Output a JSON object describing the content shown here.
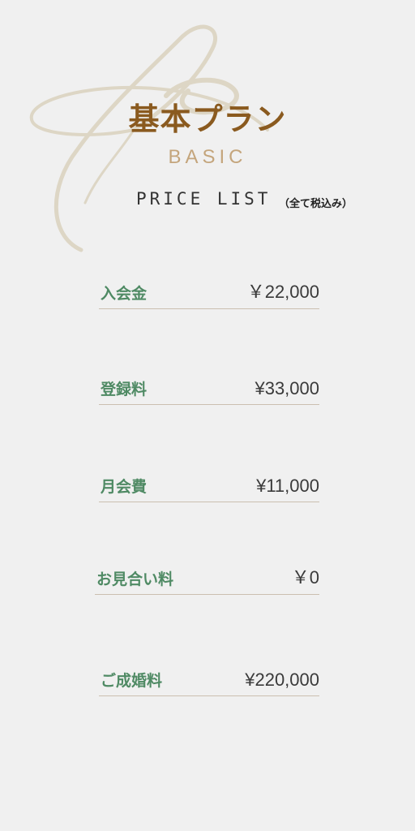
{
  "header": {
    "title": "基本プラン",
    "subtitle": "BASIC",
    "price_list_label": "PRICE LIST",
    "tax_note": "（全て税込み）"
  },
  "price_items": [
    {
      "label": "入会金",
      "value": "￥22,000"
    },
    {
      "label": "登録料",
      "value": "¥33,000"
    },
    {
      "label": "月会費",
      "value": "¥11,000"
    },
    {
      "label": "お見合い料",
      "value": "￥0"
    },
    {
      "label": "ご成婚料",
      "value": "¥220,000"
    }
  ],
  "colors": {
    "background": "#f0f0f0",
    "title": "#8a5a1f",
    "subtitle": "#c4a57c",
    "label": "#4f8a64",
    "value": "#3a3a3a",
    "divider": "#cbbfb0",
    "flourish": "#ddd6c5"
  }
}
